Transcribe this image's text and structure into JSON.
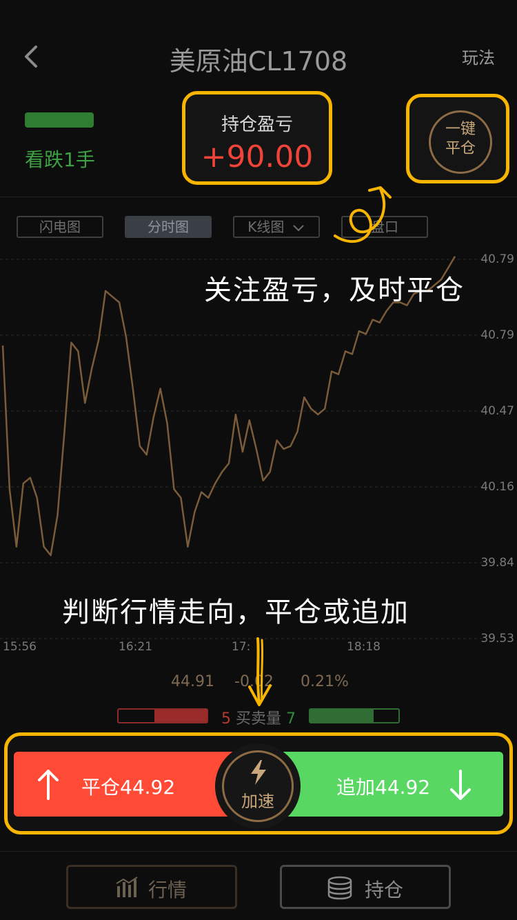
{
  "header": {
    "title": "美原油CL1708",
    "rules_link": "玩法"
  },
  "position": {
    "direction_label": "看跌1手",
    "direction_color": "#2e7d32",
    "pnl_title": "持仓盈亏",
    "pnl_value": "+90.00",
    "close_all_line1": "一键",
    "close_all_line2": "平仓"
  },
  "tabs": [
    {
      "label": "闪电图",
      "active": false
    },
    {
      "label": "分时图",
      "active": true
    },
    {
      "label": "K线图",
      "active": false
    },
    {
      "label": "盘口",
      "active": false
    }
  ],
  "chart_data": {
    "type": "line",
    "x_ticks": [
      "15:56",
      "16:21",
      "17:",
      "18:18"
    ],
    "y_ticks": [
      "40.79",
      "40.79",
      "40.47",
      "40.16",
      "39.84",
      "39.53"
    ],
    "ylim": [
      39.53,
      40.85
    ],
    "grid": true,
    "line_color": "#7a5c3a",
    "series": [
      {
        "values": [
          40.55,
          40.05,
          39.85,
          40.07,
          40.09,
          40.02,
          39.85,
          39.82,
          39.96,
          40.25,
          40.56,
          40.53,
          40.35,
          40.47,
          40.57,
          40.74,
          40.72,
          40.7,
          40.58,
          40.4,
          40.2,
          40.17,
          40.3,
          40.4,
          40.28,
          40.05,
          40.02,
          39.85,
          39.97,
          40.04,
          40.02,
          40.07,
          40.11,
          40.14,
          40.31,
          40.18,
          40.29,
          40.19,
          40.08,
          40.11,
          40.22,
          40.19,
          40.2,
          40.25,
          40.37,
          40.33,
          40.31,
          40.33,
          40.46,
          40.45,
          40.53,
          40.52,
          40.6,
          40.59,
          40.64,
          40.63,
          40.67,
          40.7,
          40.7,
          40.69,
          40.73,
          40.74,
          40.74,
          40.76,
          40.78,
          40.82,
          40.86
        ]
      }
    ]
  },
  "annotations": {
    "top": "关注盈亏，及时平仓",
    "bottom": "判断行情走向，平仓或追加"
  },
  "stats": {
    "price": "44.91",
    "change": "-0.02",
    "percent": "0.21%",
    "sell_volume": "5",
    "volume_label": "买卖量",
    "buy_volume": "7"
  },
  "trade": {
    "close_label": "平仓44.92",
    "add_label": "追加44.92",
    "accelerate_label": "加速",
    "close_color": "#ff4a36",
    "add_color": "#58d863"
  },
  "bottom_nav": {
    "market_label": "行情",
    "holdings_label": "持仓"
  }
}
